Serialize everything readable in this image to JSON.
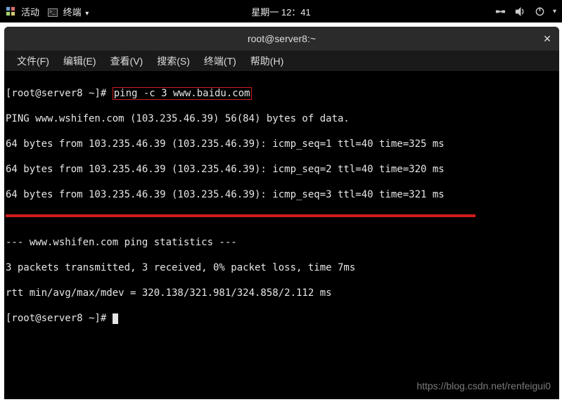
{
  "topbar": {
    "activities": "活动",
    "app_name": "终端",
    "clock": "星期一 12：41"
  },
  "tray": {
    "network": "network-icon",
    "volume": "volume-icon",
    "power": "power-icon"
  },
  "window": {
    "title": "root@server8:~"
  },
  "menu": {
    "file": "文件(F)",
    "edit": "编辑(E)",
    "view": "查看(V)",
    "search": "搜索(S)",
    "terminal": "终端(T)",
    "help": "帮助(H)"
  },
  "terminal": {
    "prompt": "[root@server8 ~]# ",
    "command": "ping -c 3 www.baidu.com",
    "line_ping_header": "PING www.wshifen.com (103.235.46.39) 56(84) bytes of data.",
    "line_reply1": "64 bytes from 103.235.46.39 (103.235.46.39): icmp_seq=1 ttl=40 time=325 ms",
    "line_reply2": "64 bytes from 103.235.46.39 (103.235.46.39): icmp_seq=2 ttl=40 time=320 ms",
    "line_reply3": "64 bytes from 103.235.46.39 (103.235.46.39): icmp_seq=3 ttl=40 time=321 ms",
    "line_stats_hdr": "--- www.wshifen.com ping statistics ---",
    "line_stats1": "3 packets transmitted, 3 received, 0% packet loss, time 7ms",
    "line_stats2": "rtt min/avg/max/mdev = 320.138/321.981/324.858/2.112 ms",
    "prompt2": "[root@server8 ~]# "
  },
  "watermark": "https://blog.csdn.net/renfeigui0"
}
